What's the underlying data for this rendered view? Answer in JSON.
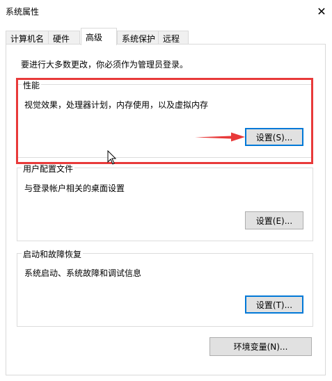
{
  "window": {
    "title": "系统属性",
    "close_symbol": "✕"
  },
  "tabs": [
    {
      "label": "计算机名",
      "active": false
    },
    {
      "label": "硬件",
      "active": false
    },
    {
      "label": "高级",
      "active": true
    },
    {
      "label": "系统保护",
      "active": false
    },
    {
      "label": "远程",
      "active": false
    }
  ],
  "admin_note": "要进行大多数更改，你必须作为管理员登录。",
  "performance": {
    "title": "性能",
    "description": "视觉效果，处理器计划，内存使用，以及虚拟内存",
    "button_label": "设置(S)..."
  },
  "user_profiles": {
    "title": "用户配置文件",
    "description": "与登录帐户相关的桌面设置",
    "button_label": "设置(E)..."
  },
  "startup_recovery": {
    "title": "启动和故障恢复",
    "description": "系统启动、系统故障和调试信息",
    "button_label": "设置(T)..."
  },
  "env_button_label": "环境变量(N)...",
  "colors": {
    "highlight": "#e83a3a",
    "focus": "#0078d7",
    "button_bg": "#e1e1e1"
  },
  "icons": {
    "close": "close-icon",
    "arrow": "red-arrow-icon",
    "cursor": "mouse-cursor-icon"
  }
}
